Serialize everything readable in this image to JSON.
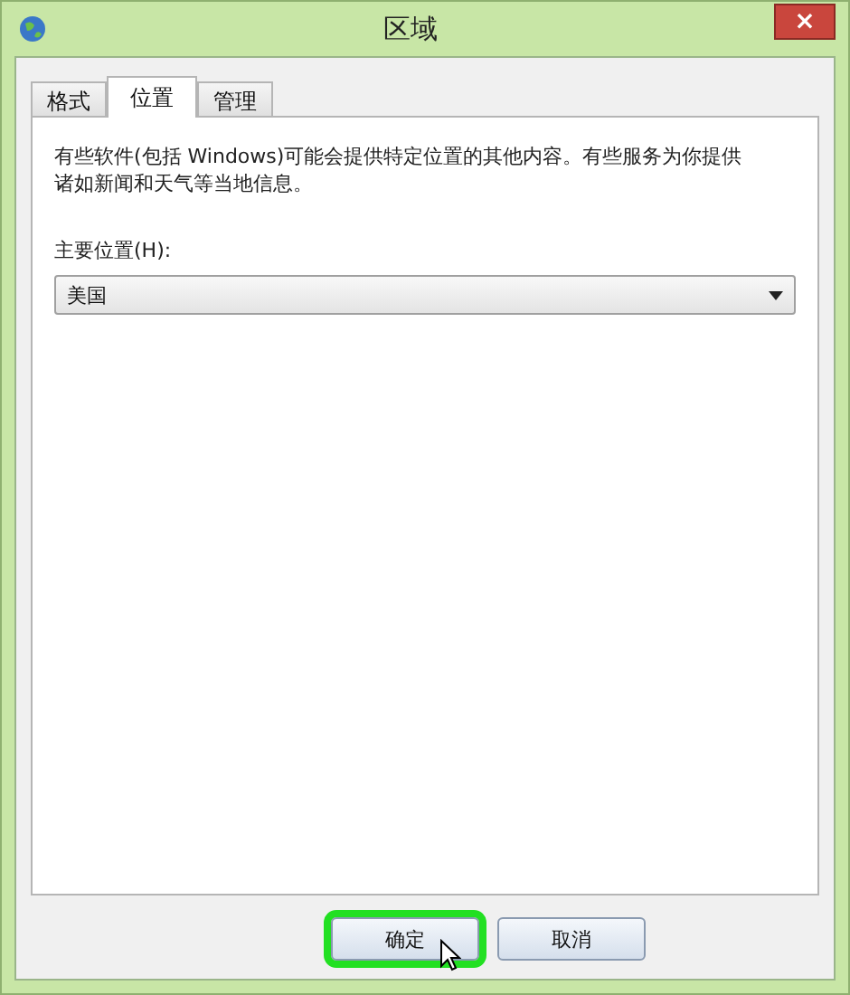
{
  "window": {
    "title": "区域",
    "close": "×"
  },
  "tabs": [
    {
      "label": "格式",
      "selected": false
    },
    {
      "label": "位置",
      "selected": true
    },
    {
      "label": "管理",
      "selected": false
    }
  ],
  "description": "有些软件(包括 Windows)可能会提供特定位置的其他内容。有些服务为你提供诸如新闻和天气等当地信息。",
  "location": {
    "label": "主要位置(H):",
    "value": "美国"
  },
  "buttons": [
    {
      "label": "确定",
      "highlighted": true
    },
    {
      "label": "取消",
      "highlighted": false
    }
  ]
}
